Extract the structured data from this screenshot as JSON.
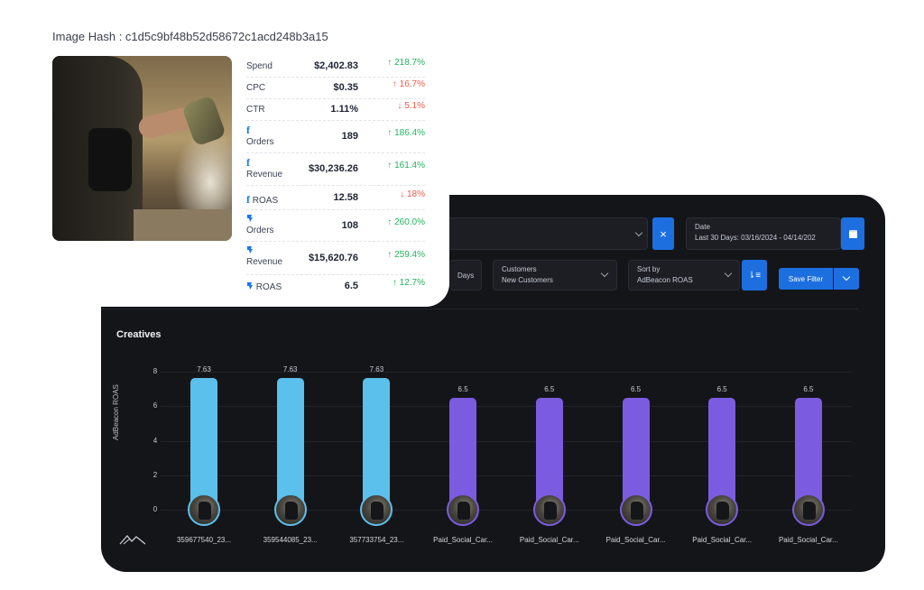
{
  "image_hash": "Image Hash : c1d5c9bf48b52d58672c1acd248b3a15",
  "stats": [
    {
      "name": "Spend",
      "icon": "",
      "value": "$2,402.83",
      "change": "↑ 218.7%",
      "dir": "up"
    },
    {
      "name": "CPC",
      "icon": "",
      "value": "$0.35",
      "change": "↑ 16.7%",
      "dir": "down"
    },
    {
      "name": "CTR",
      "icon": "",
      "value": "1.11%",
      "change": "↓ 5.1%",
      "dir": "down"
    },
    {
      "name": "Orders",
      "icon": "facebook-icon",
      "value": "189",
      "change": "↑ 186.4%",
      "dir": "up"
    },
    {
      "name": "Revenue",
      "icon": "facebook-icon",
      "value": "$30,236.26",
      "change": "↑ 161.4%",
      "dir": "up"
    },
    {
      "name": "ROAS",
      "icon": "facebook-icon",
      "value": "12.58",
      "change": "↓ 18%",
      "dir": "down"
    },
    {
      "name": "Orders",
      "icon": "adbeacon-icon",
      "value": "108",
      "change": "↑ 260.0%",
      "dir": "up"
    },
    {
      "name": "Revenue",
      "icon": "adbeacon-icon",
      "value": "$15,620.76",
      "change": "↑ 259.4%",
      "dir": "up"
    },
    {
      "name": "ROAS",
      "icon": "adbeacon-icon",
      "value": "6.5",
      "change": "↑ 12.7%",
      "dir": "up"
    }
  ],
  "filters": {
    "date_label": "Date",
    "date_value": "Last 30 Days: 03/16/2024 - 04/14/202",
    "days_label": "Days",
    "customers_label": "Customers",
    "customers_value": "New Customers",
    "sort_label": "Sort by",
    "sort_value": "AdBeacon ROAS",
    "save_filter": "Save Filter",
    "clear_symbol": "×"
  },
  "section_title": "Creatives",
  "colors": {
    "bar_top": "#5bc0eb",
    "bar_rest": "#7b5ce0",
    "up": "#22b35e",
    "down": "#ef5a4a",
    "accent": "#1d6fe0"
  },
  "chart_data": {
    "type": "bar",
    "ylabel": "AdBeacon ROAS",
    "ylim": [
      0,
      8
    ],
    "yticks": [
      "0",
      "2",
      "4",
      "6",
      "8"
    ],
    "categories": [
      "359677540_23...",
      "359544085_23...",
      "357733754_23...",
      "Paid_Social_Car...",
      "Paid_Social_Car...",
      "Paid_Social_Car...",
      "Paid_Social_Car...",
      "Paid_Social_Car..."
    ],
    "values": [
      7.63,
      7.63,
      7.63,
      6.5,
      6.5,
      6.5,
      6.5,
      6.5
    ],
    "value_labels": [
      "7.63",
      "7.63",
      "7.63",
      "6.5",
      "6.5",
      "6.5",
      "6.5",
      "6.5"
    ],
    "grid": true
  }
}
